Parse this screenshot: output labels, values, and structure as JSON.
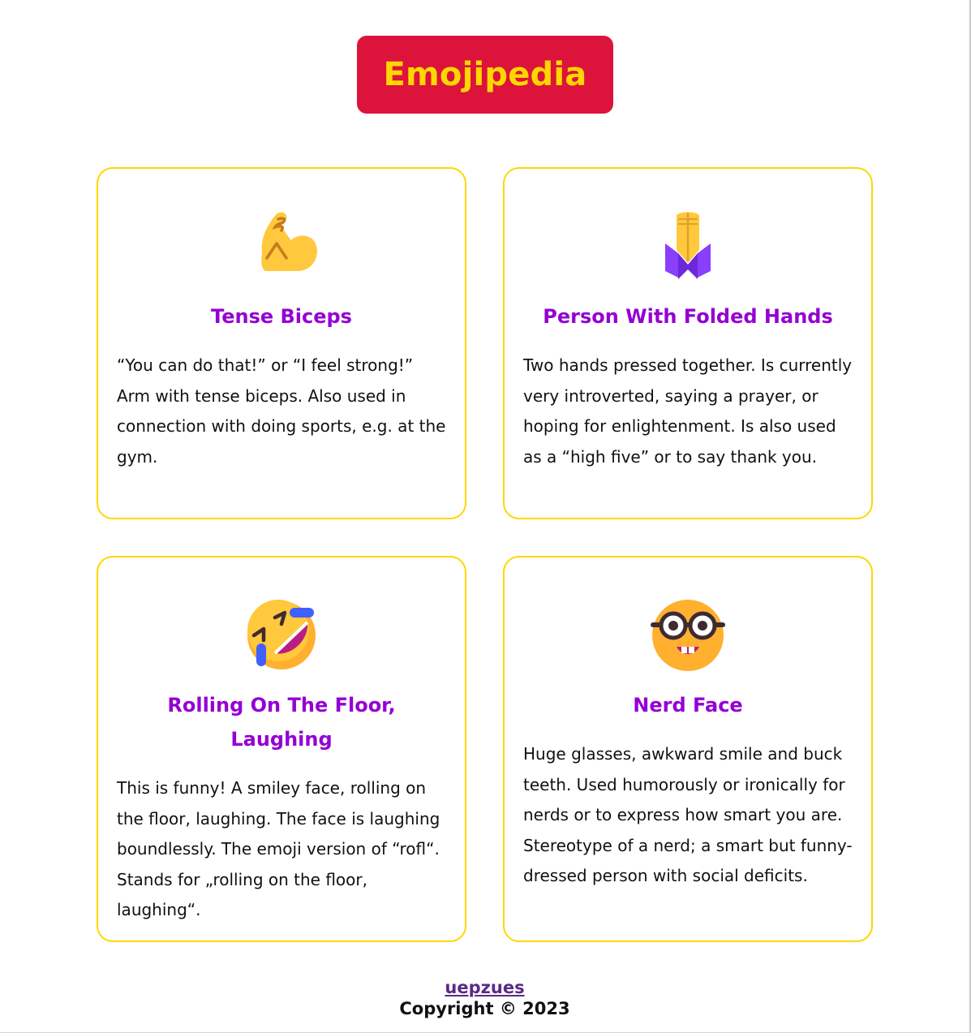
{
  "header": {
    "title": "Emojipedia"
  },
  "colors": {
    "banner_bg": "#dc143c",
    "banner_text": "#ffd700",
    "card_border": "#ffd700",
    "card_title": "#9400d3",
    "footer_link": "#5b2a86"
  },
  "cards": [
    {
      "icon": "flexed-biceps-icon",
      "title": "Tense Biceps",
      "description": "“You can do that!” or “I feel strong!” Arm with tense biceps. Also used in connection with doing sports, e.g. at the gym."
    },
    {
      "icon": "folded-hands-icon",
      "title": "Person With Folded Hands",
      "description": "Two hands pressed together. Is currently very introverted, saying a prayer, or hoping for enlightenment. Is also used as a “high five” or to say thank you."
    },
    {
      "icon": "rolling-on-floor-laughing-icon",
      "title": "Rolling On The Floor, Laughing",
      "description": "This is funny! A smiley face, rolling on the floor, laughing. The face is laughing boundlessly. The emoji version of “rofl“. Stands for „rolling on the floor, laughing“."
    },
    {
      "icon": "nerd-face-icon",
      "title": "Nerd Face",
      "description": "Huge glasses, awkward smile and buck teeth. Used humorously or ironically for nerds or to express how smart you are. Stereotype of a nerd; a smart but funny-dressed person with social deficits."
    }
  ],
  "footer": {
    "author_link": "uepzues",
    "copyright": "Copyright © 2023"
  }
}
